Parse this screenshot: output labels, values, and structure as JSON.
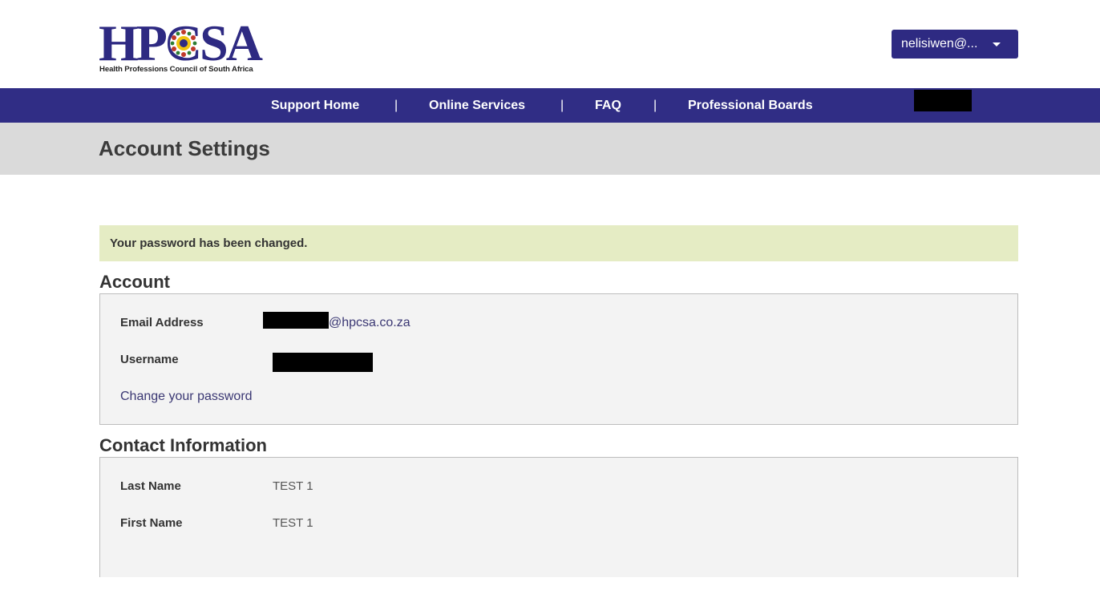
{
  "header": {
    "logo_text": "HPCSA",
    "logo_subtitle": "Health Professions Council of South Africa",
    "user_menu_label": "nelisiwen@..."
  },
  "nav": {
    "items": [
      "Support Home",
      "Online Services",
      "FAQ",
      "Professional Boards"
    ],
    "separator": "|"
  },
  "page": {
    "title": "Account Settings"
  },
  "alert": {
    "message": "Your password has been changed."
  },
  "account": {
    "heading": "Account",
    "email_label": "Email Address",
    "email_value": "@hpcsa.co.za",
    "username_label": "Username",
    "change_password_link": "Change your password"
  },
  "contact": {
    "heading": "Contact Information",
    "last_name_label": "Last Name",
    "last_name_value": "TEST 1",
    "first_name_label": "First Name",
    "first_name_value": "TEST 1"
  },
  "colors": {
    "brand": "#2e2a82",
    "nav_bg": "#302d85",
    "alert_bg": "#e5ecc4",
    "title_band": "#dadada"
  }
}
